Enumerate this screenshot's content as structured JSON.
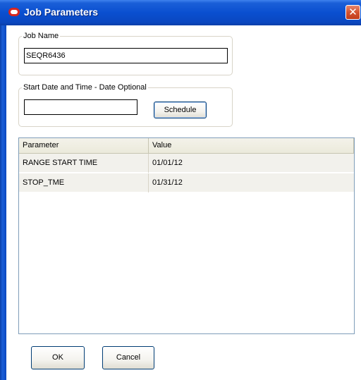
{
  "window": {
    "title": "Job Parameters",
    "close_glyph": "✕"
  },
  "job_name": {
    "label": "Job Name",
    "value": "SEQR6436"
  },
  "start_date": {
    "label": "Start Date and Time - Date Optional",
    "value": "",
    "schedule_label": "Schedule"
  },
  "parameters_table": {
    "columns": [
      "Parameter",
      "Value"
    ],
    "rows": [
      {
        "parameter": "RANGE START TIME",
        "value": "01/01/12"
      },
      {
        "parameter": "STOP_TME",
        "value": "01/31/12"
      }
    ]
  },
  "footer": {
    "ok_label": "OK",
    "cancel_label": "Cancel"
  },
  "icons": {
    "app": "oracle-icon",
    "close": "close-icon"
  },
  "colors": {
    "titlebar": "#0a4fd0",
    "close_button": "#d4532f",
    "table_row": "#f2f1ec"
  }
}
